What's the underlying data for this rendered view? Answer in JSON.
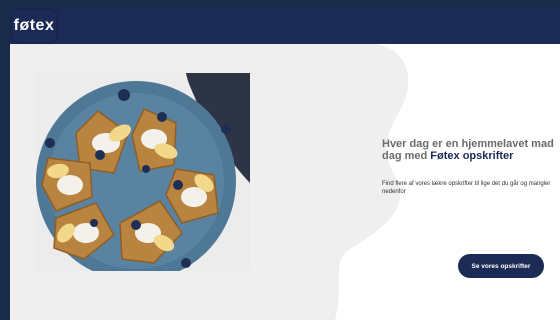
{
  "header": {
    "logo_text": "føtex"
  },
  "hero": {
    "headline_part1": "Hver dag er en hjemmelavet mad dag med ",
    "headline_brand": "Føtex opskrifter",
    "body": "Find flere af vores lækre opskrifter til lige det du går og mangler nedenfor",
    "cta_label": "Se vores opskrifter"
  },
  "colors": {
    "brand_navy": "#1b2b55",
    "cloud_gray": "#efefef",
    "text_gray": "#6b6b6b"
  },
  "icons": {
    "photo": "waffles-food-photo"
  }
}
